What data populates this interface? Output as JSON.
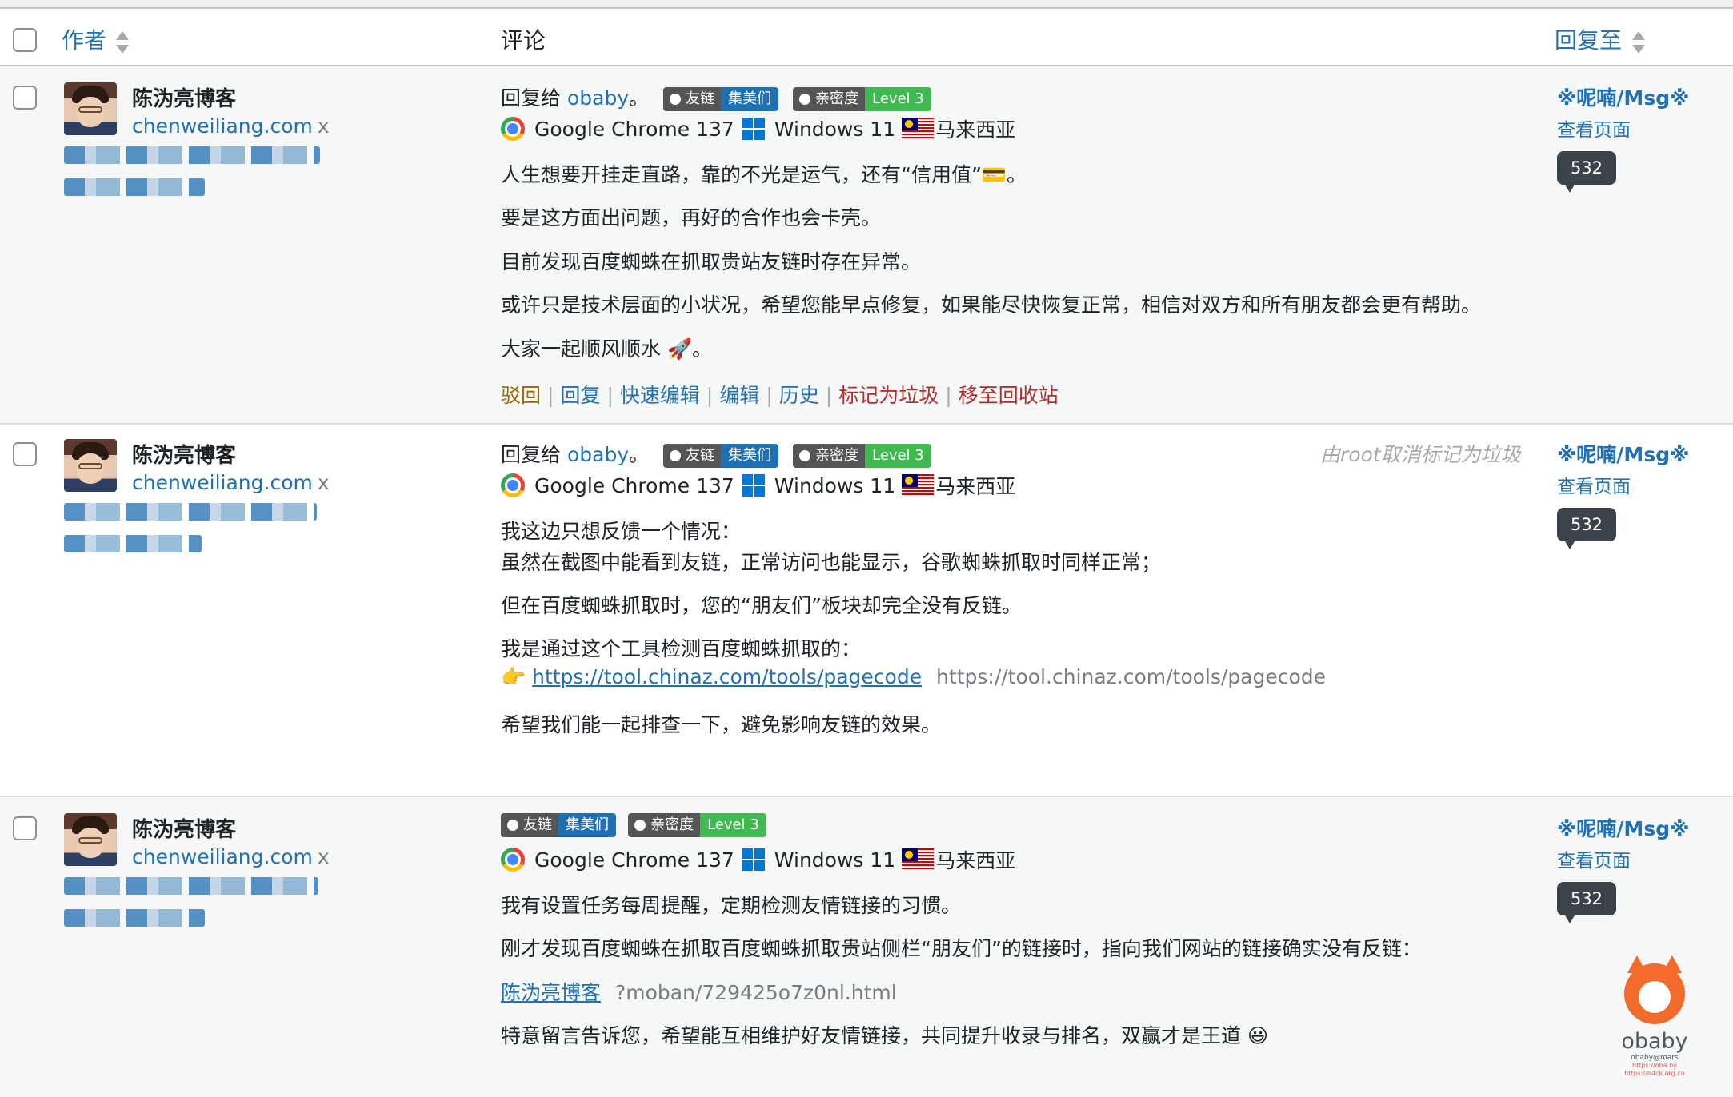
{
  "header": {
    "author_label": "作者",
    "comment_label": "评论",
    "reply_to_label": "回复至"
  },
  "comments": [
    {
      "author": "陈沩亮博客",
      "url": "chenweiliang.com",
      "remove": "x",
      "reply_prefix": "回复给",
      "reply_to": "obaby",
      "reply_suffix": "。",
      "badge_link_l": "友链",
      "badge_link_r": "集美们",
      "badge_intimacy_l": "亲密度",
      "badge_intimacy_r": "Level 3",
      "browser": "Google Chrome 137",
      "os": "Windows 11",
      "country": "马来西亚",
      "lines": [
        "人生想要开挂走直路，靠的不光是运气，还有“信用值”💳。",
        "要是这方面出问题，再好的合作也会卡壳。",
        "目前发现百度蜘蛛在抓取贵站友链时存在异常。",
        "或许只是技术层面的小状况，希望您能早点修复，如果能尽快恢复正常，相信对双方和所有朋友都会更有帮助。",
        "大家一起顺风顺水 🚀。"
      ],
      "actions": {
        "approve": "驳回",
        "reply": "回复",
        "quick_edit": "快速编辑",
        "edit": "编辑",
        "history": "历史",
        "spam": "标记为垃圾",
        "trash": "移至回收站"
      },
      "post_title": "※呢喃/Msg※",
      "view_page": "查看页面",
      "count": "532"
    },
    {
      "author": "陈沩亮博客",
      "url": "chenweiliang.com",
      "remove": "x",
      "reply_prefix": "回复给",
      "reply_to": "obaby",
      "reply_suffix": "。",
      "badge_link_l": "友链",
      "badge_link_r": "集美们",
      "badge_intimacy_l": "亲密度",
      "badge_intimacy_r": "Level 3",
      "note": "由root取消标记为垃圾",
      "browser": "Google Chrome 137",
      "os": "Windows 11",
      "country": "马来西亚",
      "lines": [
        "我这边只想反馈一个情况：",
        "虽然在截图中能看到友链，正常访问也能显示，谷歌蜘蛛抓取时同样正常；",
        "但在百度蜘蛛抓取时，您的“朋友们”板块却完全没有反链。",
        "我是通过这个工具检测百度蜘蛛抓取的："
      ],
      "link_emoji": "👉",
      "link_text": "https://tool.chinaz.com/tools/pagecode",
      "link_plain": "https://tool.chinaz.com/tools/pagecode",
      "last_line": "希望我们能一起排查一下，避免影响友链的效果。",
      "post_title": "※呢喃/Msg※",
      "view_page": "查看页面",
      "count": "532"
    },
    {
      "author": "陈沩亮博客",
      "url": "chenweiliang.com",
      "remove": "x",
      "badge_link_l": "友链",
      "badge_link_r": "集美们",
      "badge_intimacy_l": "亲密度",
      "badge_intimacy_r": "Level 3",
      "browser": "Google Chrome 137",
      "os": "Windows 11",
      "country": "马来西亚",
      "lines": [
        "我有设置任务每周提醒，定期检测友情链接的习惯。",
        "刚才发现百度蜘蛛在抓取百度蜘蛛抓取贵站侧栏“朋友们”的链接时，指向我们网站的链接确实没有反链："
      ],
      "link_text": "陈沩亮博客",
      "link_plain": "?moban/729425o7z0nl.html",
      "last_line": "特意留言告诉您，希望能互相维护好友情链接，共同提升收录与排名，双赢才是王道 😃",
      "post_title": "※呢喃/Msg※",
      "view_page": "查看页面",
      "count": "532"
    }
  ],
  "watermark": {
    "word": "obaby",
    "small": "obaby@mars",
    "url1": "https://oba.by",
    "url2": "https://h4ck.org.cn"
  }
}
